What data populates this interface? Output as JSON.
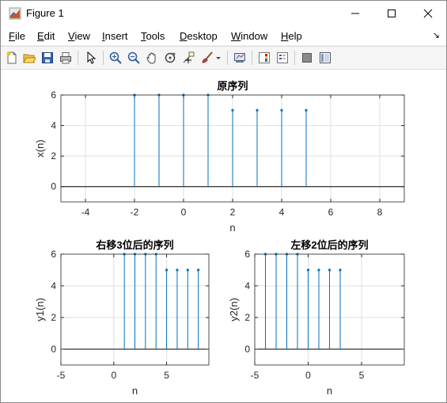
{
  "window": {
    "title": "Figure 1",
    "menu": [
      {
        "label": "File",
        "ul": "F",
        "rest": "ile"
      },
      {
        "label": "Edit",
        "ul": "E",
        "rest": "dit"
      },
      {
        "label": "View",
        "ul": "V",
        "rest": "iew"
      },
      {
        "label": "Insert",
        "ul": "I",
        "rest": "nsert"
      },
      {
        "label": "Tools",
        "ul": "T",
        "rest": "ools"
      },
      {
        "label": "Desktop",
        "ul": "D",
        "rest": "esktop"
      },
      {
        "label": "Window",
        "ul": "W",
        "rest": "indow"
      },
      {
        "label": "Help",
        "ul": "H",
        "rest": "elp"
      }
    ],
    "toolbar": [
      "new-figure-icon",
      "open-file-icon",
      "save-icon",
      "print-icon",
      "pointer-icon",
      "zoom-in-icon",
      "zoom-out-icon",
      "pan-icon",
      "rotate-3d-icon",
      "data-cursor-icon",
      "brush-icon",
      "link-plot-icon",
      "insert-colorbar-icon",
      "insert-legend-icon",
      "hide-plot-tools-icon",
      "show-plot-tools-icon"
    ]
  },
  "colors": {
    "stem": "#0072bd",
    "grid": "#dfdfdf",
    "axis": "#262626"
  },
  "chart_data": [
    {
      "type": "stem",
      "title": "原序列",
      "xlabel": "n",
      "ylabel": "x(n)",
      "xlim": [
        -5,
        9
      ],
      "ylim": [
        -1,
        6
      ],
      "xticks": [
        -4,
        -2,
        0,
        2,
        4,
        6,
        8
      ],
      "yticks": [
        0,
        2,
        4,
        6
      ],
      "x": [
        -2,
        -1,
        0,
        1,
        2,
        3,
        4,
        5
      ],
      "y": [
        6,
        6,
        6,
        6,
        5,
        5,
        5,
        5
      ],
      "grid": true
    },
    {
      "type": "stem",
      "title": "右移3位后的序列",
      "xlabel": "n",
      "ylabel": "y1(n)",
      "xlim": [
        -5,
        9
      ],
      "ylim": [
        -1,
        6
      ],
      "xticks": [
        -5,
        0,
        5
      ],
      "yticks": [
        0,
        2,
        4,
        6
      ],
      "x": [
        1,
        2,
        3,
        4,
        5,
        6,
        7,
        8
      ],
      "y": [
        6,
        6,
        6,
        6,
        5,
        5,
        5,
        5
      ],
      "grid": true
    },
    {
      "type": "stem",
      "title": "左移2位后的序列",
      "xlabel": "n",
      "ylabel": "y2(n)",
      "xlim": [
        -5,
        9
      ],
      "ylim": [
        -1,
        6
      ],
      "xticks": [
        -5,
        0,
        5
      ],
      "yticks": [
        0,
        2,
        4,
        6
      ],
      "x": [
        -4,
        -3,
        -2,
        -1,
        0,
        1,
        2,
        3
      ],
      "y": [
        6,
        6,
        6,
        6,
        5,
        5,
        5,
        5
      ],
      "grid": true
    }
  ]
}
